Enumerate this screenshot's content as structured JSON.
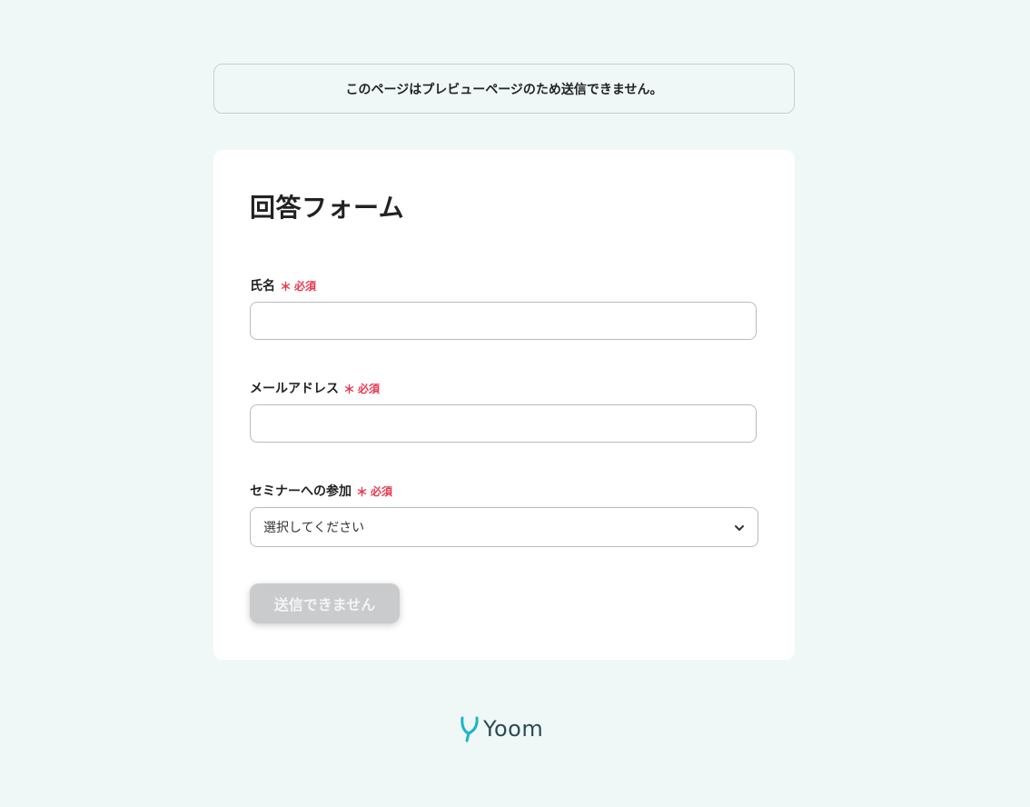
{
  "notice": {
    "text": "このページはプレビューページのため送信できません。"
  },
  "form": {
    "title": "回答フォーム",
    "required_mark": "＊",
    "required_label": "必須",
    "fields": [
      {
        "label": "氏名",
        "value": ""
      },
      {
        "label": "メールアドレス",
        "value": ""
      },
      {
        "label": "セミナーへの参加",
        "selected": "選択してください"
      }
    ],
    "submit_label": "送信できません"
  },
  "footer": {
    "logo_text": "Yoom",
    "logo_icon": "yoom-leaf-icon"
  },
  "colors": {
    "background": "#f0f8f7",
    "required": "#e8384f",
    "brand_teal": "#19b5c8",
    "logo_text": "#2a4a56",
    "disabled_button": "#c9cbcc"
  }
}
